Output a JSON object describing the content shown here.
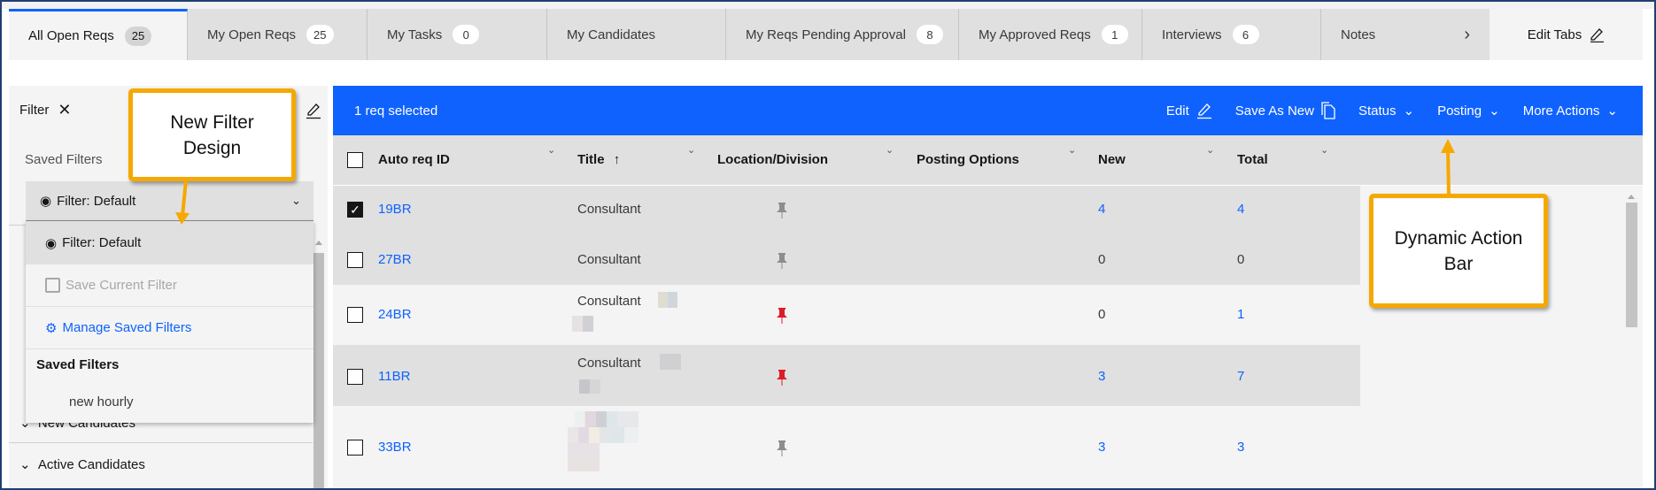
{
  "tabs": [
    {
      "label": "All Open Reqs",
      "count": "25",
      "active": true
    },
    {
      "label": "My Open Reqs",
      "count": "25"
    },
    {
      "label": "My Tasks",
      "count": "0"
    },
    {
      "label": "My Candidates"
    },
    {
      "label": "My Reqs Pending Approval",
      "count": "8"
    },
    {
      "label": "My Approved Reqs",
      "count": "1"
    },
    {
      "label": "Interviews",
      "count": "6"
    },
    {
      "label": "Notes"
    }
  ],
  "edit_tabs_label": "Edit Tabs",
  "sidebar": {
    "filter_label": "Filter",
    "saved_filters_label": "Saved Filters",
    "dropdown_value": "Filter: Default",
    "menu": {
      "default": "Filter: Default",
      "save": "Save Current Filter",
      "manage": "Manage Saved Filters",
      "section": "Saved Filters",
      "saved": [
        "new hourly"
      ]
    },
    "accordion": [
      "New Candidates",
      "Active Candidates"
    ]
  },
  "action_bar": {
    "selected_text": "1 req selected",
    "edit": "Edit",
    "save_as_new": "Save As New",
    "status": "Status",
    "posting": "Posting",
    "more_actions": "More Actions"
  },
  "table": {
    "columns": [
      "Auto req ID",
      "Title",
      "Location/Division",
      "Posting Options",
      "New",
      "Total"
    ],
    "rows": [
      {
        "id": "19BR",
        "title": "Consultant",
        "posted": false,
        "new": "4",
        "total": "4",
        "checked": true
      },
      {
        "id": "27BR",
        "title": "Consultant",
        "posted": false,
        "new": "0",
        "total": "0"
      },
      {
        "id": "24BR",
        "title": "Consultant",
        "posted": true,
        "new": "0",
        "total": "1"
      },
      {
        "id": "11BR",
        "title": "Consultant",
        "posted": true,
        "new": "3",
        "total": "7"
      },
      {
        "id": "33BR",
        "title": "",
        "posted": false,
        "new": "3",
        "total": "3"
      }
    ]
  },
  "annotations": {
    "filter_callout": [
      "New Filter",
      "Design"
    ],
    "action_callout": [
      "Dynamic Action",
      "Bar"
    ]
  },
  "colors": {
    "accent": "#0f62fe",
    "callout": "#f5a800",
    "pin_posted": "#da1e28",
    "pin_unposted": "#8d8d8d"
  }
}
